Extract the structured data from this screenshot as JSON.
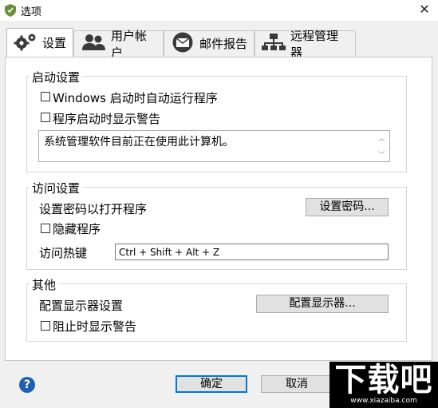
{
  "window": {
    "title": "选项",
    "close_glyph": "✕"
  },
  "tabs": [
    {
      "label": "设置",
      "icon": "gears-icon",
      "active": true
    },
    {
      "label": "用户帐户",
      "icon": "users-icon",
      "active": false
    },
    {
      "label": "邮件报告",
      "icon": "mail-icon",
      "active": false
    },
    {
      "label": "远程管理器",
      "icon": "network-icon",
      "active": false
    }
  ],
  "startup": {
    "title": "启动设置",
    "autorun_label": "Windows 启动时自动运行程序",
    "warning_label": "程序启动时显示警告",
    "warning_text": "系统管理软件目前正在使用此计算机。"
  },
  "access": {
    "title": "访问设置",
    "password_label": "设置密码以打开程序",
    "password_button": "设置密码...",
    "hide_label": "隐藏程序",
    "hotkey_label": "访问热键",
    "hotkey_value": "Ctrl + Shift + Alt + Z"
  },
  "other": {
    "title": "其他",
    "monitor_label": "配置显示器设置",
    "monitor_button": "配置显示器...",
    "block_warning_label": "阻止时显示警告"
  },
  "footer": {
    "help_glyph": "?",
    "ok_label": "确定",
    "cancel_label": "取消"
  },
  "watermark": {
    "big": "下载吧",
    "small": "www.xiazaiba.com"
  },
  "colors": {
    "accent": "#0078d7",
    "help": "#1e5fb4"
  }
}
